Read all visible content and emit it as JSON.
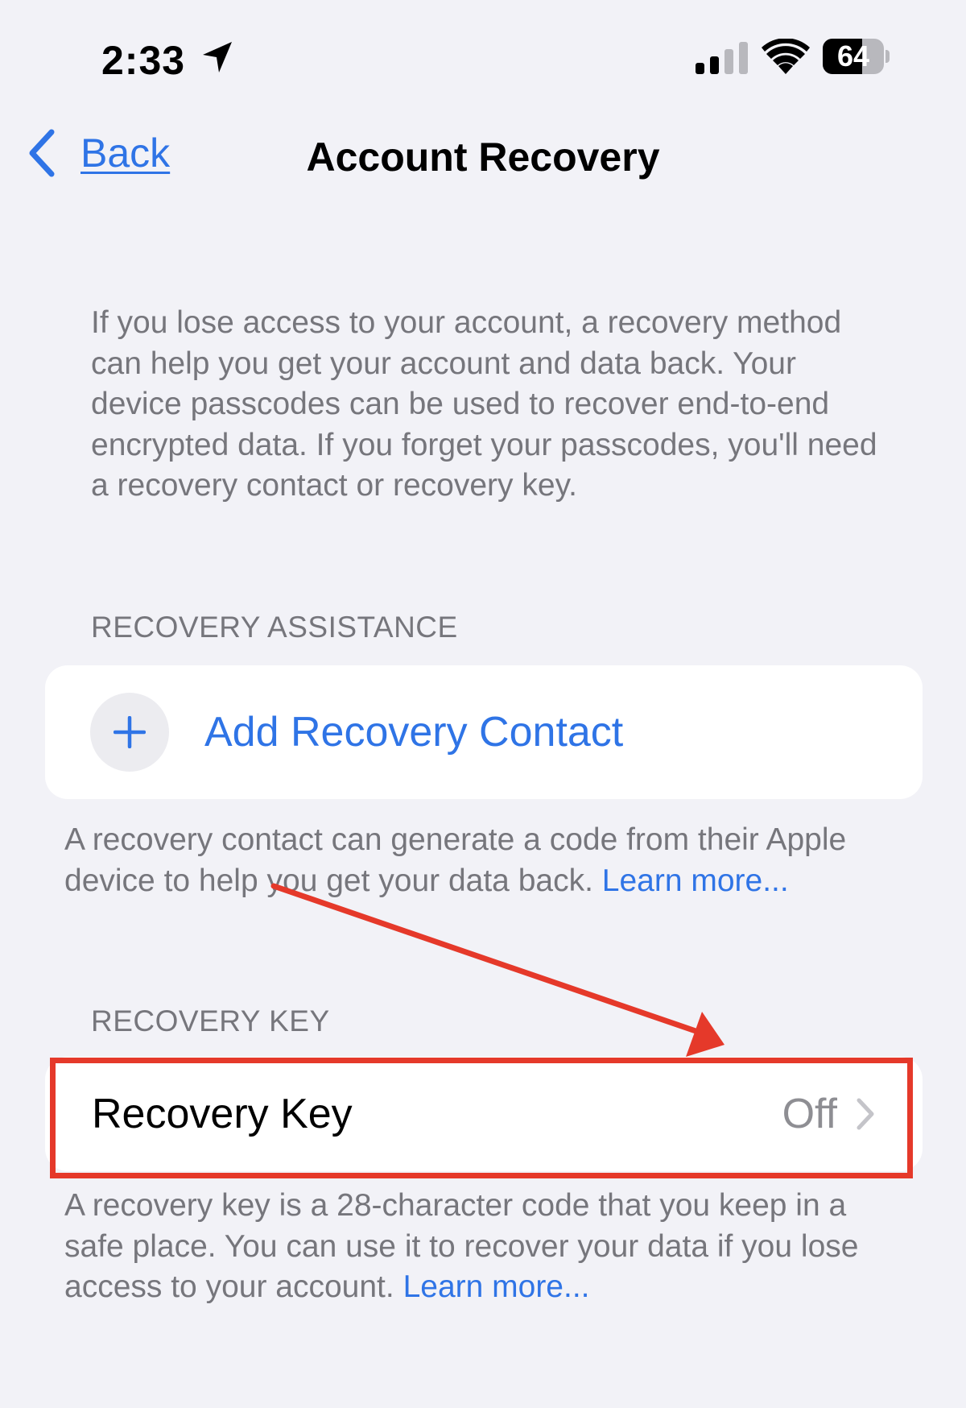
{
  "status_bar": {
    "time": "2:33",
    "battery": "64",
    "battery_level": 0.64,
    "location_icon": "location-arrow-icon",
    "signal_icon": "cellular-signal-icon",
    "wifi_icon": "wifi-icon"
  },
  "nav": {
    "back_label": "Back",
    "title": "Account Recovery",
    "back_icon": "chevron-left-icon"
  },
  "intro": "If you lose access to your account, a recovery method can help you get your account and data back. Your device passcodes can be used to recover end-to-end encrypted data. If you forget your passcodes, you'll need a recovery contact or recovery key.",
  "recovery_assistance": {
    "header": "RECOVERY ASSISTANCE",
    "add_contact_label": "Add Recovery Contact",
    "add_icon": "plus-icon",
    "footer_text": "A recovery contact can generate a code from their Apple device to help you get your data back.",
    "footer_link": "Learn more..."
  },
  "recovery_key": {
    "header": "RECOVERY KEY",
    "label": "Recovery Key",
    "value": "Off",
    "chevron_icon": "chevron-right-icon",
    "footer_text": "A recovery key is a 28-character code that you keep in a safe place. You can use it to recover your data if you lose access to your account.",
    "footer_link": "Learn more..."
  },
  "colors": {
    "accent": "#2f74e6",
    "background": "#f2f2f7",
    "annotation": "#e5392a",
    "secondary_text": "#76767c"
  }
}
